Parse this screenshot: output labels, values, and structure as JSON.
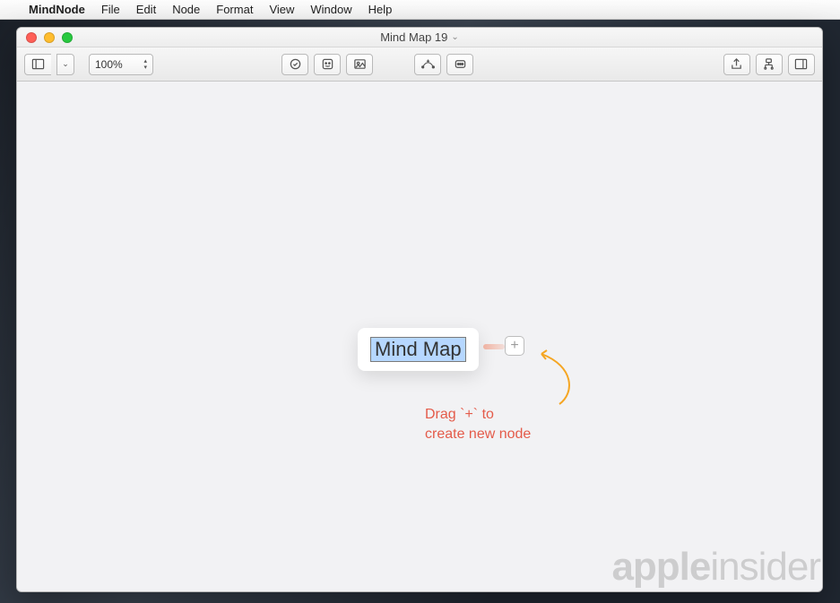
{
  "menubar": {
    "app_name": "MindNode",
    "items": [
      "File",
      "Edit",
      "Node",
      "Format",
      "View",
      "Window",
      "Help"
    ]
  },
  "window": {
    "title": "Mind Map 19"
  },
  "toolbar": {
    "zoom_value": "100%"
  },
  "canvas": {
    "root_node_text": "Mind Map",
    "tip_line1": "Drag `+` to",
    "tip_line2": "create new node"
  },
  "watermark": {
    "bold": "apple",
    "thin": "insider"
  }
}
